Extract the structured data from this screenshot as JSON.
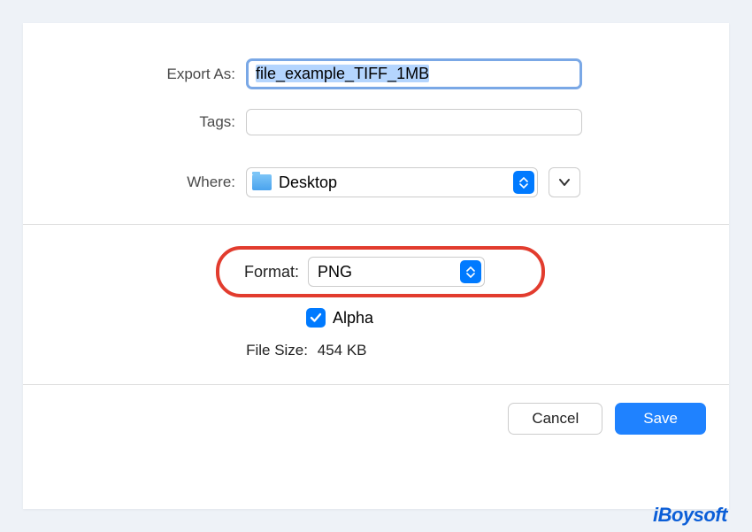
{
  "labels": {
    "exportAs": "Export As:",
    "tags": "Tags:",
    "where": "Where:",
    "format": "Format:",
    "alpha": "Alpha",
    "fileSize": "File Size:"
  },
  "values": {
    "filename": "file_example_TIFF_1MB",
    "tags": "",
    "location": "Desktop",
    "format": "PNG",
    "alphaChecked": true,
    "fileSize": "454 KB"
  },
  "buttons": {
    "cancel": "Cancel",
    "save": "Save"
  },
  "watermark": "iBoysoft"
}
